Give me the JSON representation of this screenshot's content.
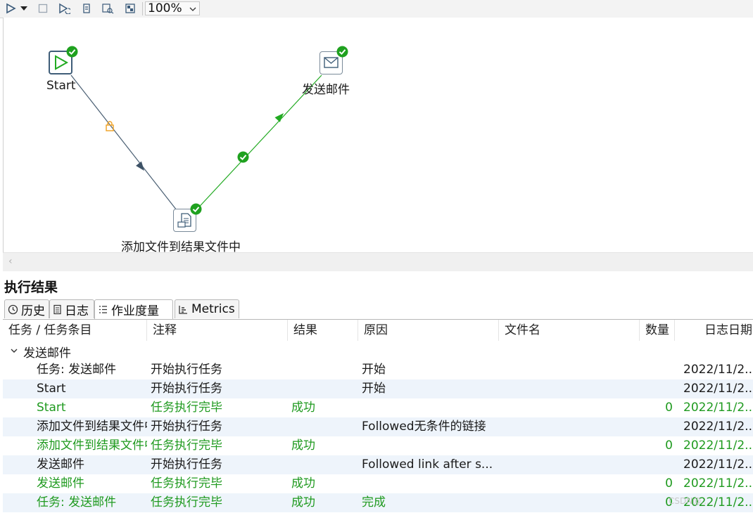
{
  "toolbar": {
    "zoom": "100%",
    "icons": [
      "run-icon",
      "run-dropdown-icon",
      "stop-icon",
      "replay-icon",
      "verify-icon",
      "preview-icon",
      "impact-icon"
    ]
  },
  "canvas": {
    "nodes": {
      "start": {
        "label": "Start",
        "icon": "start-icon",
        "status": "success"
      },
      "add_files": {
        "label": "添加文件到结果文件中",
        "icon": "file-add-icon",
        "status": "success"
      },
      "send_mail": {
        "label": "发送邮件",
        "icon": "mail-icon",
        "status": "success"
      }
    },
    "hops": [
      {
        "from": "start",
        "to": "add_files",
        "type": "unconditional",
        "color": "#4a5f73"
      },
      {
        "from": "add_files",
        "to": "send_mail",
        "type": "on-success",
        "color": "#22aa22"
      }
    ]
  },
  "results": {
    "title": "执行结果",
    "tabs": [
      {
        "label": "历史",
        "icon": "history-icon"
      },
      {
        "label": "日志",
        "icon": "log-icon"
      },
      {
        "label": "作业度量",
        "icon": "job-metrics-icon"
      },
      {
        "label": "Metrics",
        "icon": "metrics-icon"
      }
    ],
    "active_tab": "作业度量",
    "columns": [
      "任务 / 任务条目",
      "注释",
      "结果",
      "原因",
      "文件名",
      "数量",
      "日志日期"
    ],
    "group": "发送邮件",
    "rows": [
      {
        "task": "任务: 发送邮件",
        "comment": "开始执行任务",
        "result": "",
        "reason": "开始",
        "file": "",
        "count": "",
        "date": "2022/11/2...",
        "green": false
      },
      {
        "task": "Start",
        "comment": "开始执行任务",
        "result": "",
        "reason": "开始",
        "file": "",
        "count": "",
        "date": "2022/11/2...",
        "green": false
      },
      {
        "task": "Start",
        "comment": "任务执行完毕",
        "result": "成功",
        "reason": "",
        "file": "",
        "count": "0",
        "date": "2022/11/2...",
        "green": true
      },
      {
        "task": "添加文件到结果文件中",
        "comment": "开始执行任务",
        "result": "",
        "reason": "Followed无条件的链接",
        "file": "",
        "count": "",
        "date": "2022/11/2...",
        "green": false
      },
      {
        "task": "添加文件到结果文件中",
        "comment": "任务执行完毕",
        "result": "成功",
        "reason": "",
        "file": "",
        "count": "0",
        "date": "2022/11/2...",
        "green": true
      },
      {
        "task": "发送邮件",
        "comment": "开始执行任务",
        "result": "",
        "reason": "Followed link after s...",
        "file": "",
        "count": "",
        "date": "2022/11/2...",
        "green": false
      },
      {
        "task": "发送邮件",
        "comment": "任务执行完毕",
        "result": "成功",
        "reason": "",
        "file": "",
        "count": "0",
        "date": "2022/11/2...",
        "green": true
      },
      {
        "task": "任务: 发送邮件",
        "comment": "任务执行完毕",
        "result": "成功",
        "reason": "完成",
        "file": "",
        "count": "0",
        "date": "2022/11/2...",
        "green": true
      }
    ]
  },
  "watermark": "CSDN@..."
}
